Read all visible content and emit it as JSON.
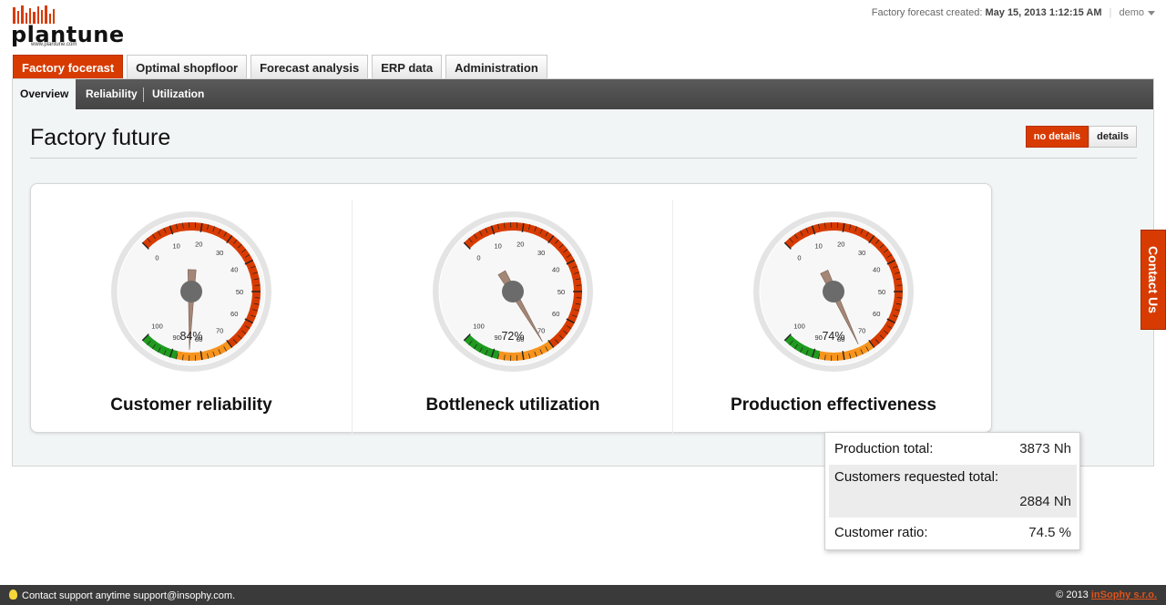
{
  "header": {
    "logo_text": "plantune",
    "logo_url": "www.plantune.com",
    "forecast_label": "Factory forecast created:",
    "forecast_date": "May 15, 2013 1:12:15 AM",
    "user": "demo"
  },
  "main_tabs": [
    {
      "label": "Factory focerast",
      "active": true
    },
    {
      "label": "Optimal shopfloor",
      "active": false
    },
    {
      "label": "Forecast analysis",
      "active": false
    },
    {
      "label": "ERP data",
      "active": false
    },
    {
      "label": "Administration",
      "active": false
    }
  ],
  "sub_tabs": [
    {
      "label": "Overview",
      "active": true
    },
    {
      "label": "Reliability",
      "active": false
    },
    {
      "label": "Utilization",
      "active": false
    }
  ],
  "page_title": "Factory future",
  "view_toggle": {
    "no_details": "no details",
    "details": "details",
    "selected": "no details"
  },
  "gauge_colors": {
    "red": "#d83b01",
    "orange": "#f7941d",
    "green": "#1f9a1f"
  },
  "gauges": [
    {
      "title": "Customer reliability",
      "value": 84,
      "display": "84%",
      "ticks": [
        "0",
        "10",
        "20",
        "30",
        "40",
        "50",
        "60",
        "70",
        "80",
        "90",
        "100"
      ]
    },
    {
      "title": "Bottleneck utilization",
      "value": 72,
      "display": "72%",
      "ticks": [
        "0",
        "10",
        "20",
        "30",
        "40",
        "50",
        "60",
        "70",
        "80",
        "90",
        "100"
      ]
    },
    {
      "title": "Production effectiveness",
      "value": 74,
      "display": "74%",
      "ticks": [
        "0",
        "10",
        "20",
        "30",
        "40",
        "50",
        "60",
        "70",
        "80",
        "90",
        "100"
      ]
    }
  ],
  "stats": {
    "production_total_label": "Production total:",
    "production_total_value": "3873 Nh",
    "customers_requested_label": "Customers requested total:",
    "customers_requested_value": "2884 Nh",
    "customer_ratio_label": "Customer ratio:",
    "customer_ratio_value": "74.5 %"
  },
  "contact": "Contact Us",
  "footer": {
    "support": "Contact support anytime support@insophy.com.",
    "copyright": "© 2013",
    "company": "inSophy s.r.o."
  }
}
